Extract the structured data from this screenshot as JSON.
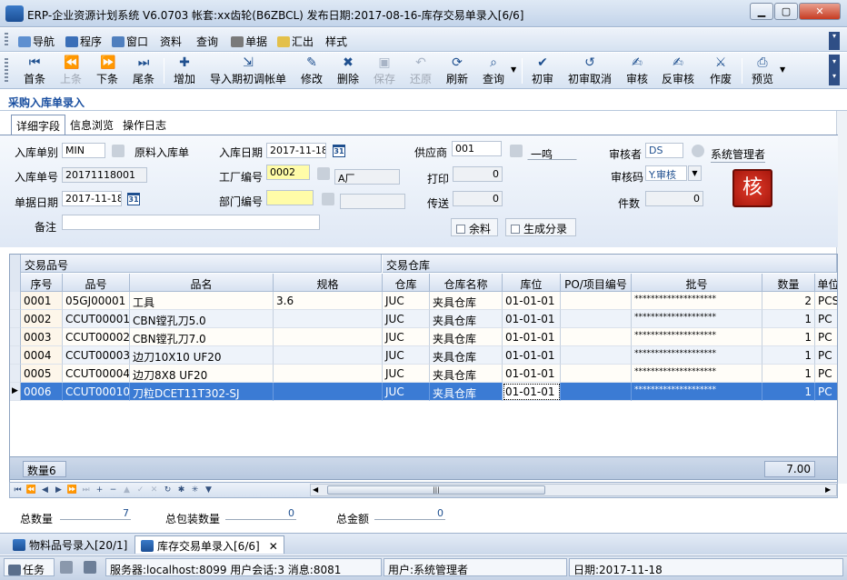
{
  "window": {
    "title": "ERP-企业资源计划系统 V6.0703 帐套:xx齿轮(B6ZBCL) 发布日期:2017-08-16-库存交易单录入[6/6]",
    "min": "▁",
    "max": "▢",
    "close": "✕"
  },
  "menu": {
    "items": [
      "导航",
      "程序",
      "窗口",
      "资料",
      "查询",
      "单据",
      "汇出",
      "样式"
    ]
  },
  "toolbar": {
    "buttons": [
      {
        "label": "首条",
        "icon": "first-record-icon",
        "glyph": "⏮"
      },
      {
        "label": "上条",
        "icon": "prev-record-icon",
        "glyph": "⏪"
      },
      {
        "label": "下条",
        "icon": "next-record-icon",
        "glyph": "⏩"
      },
      {
        "label": "尾条",
        "icon": "last-record-icon",
        "glyph": "⏭"
      },
      {
        "label": "增加",
        "icon": "add-icon",
        "glyph": "✚"
      },
      {
        "label": "导入期初调帐单",
        "icon": "import-icon",
        "glyph": "⇲"
      },
      {
        "label": "修改",
        "icon": "edit-icon",
        "glyph": "✎"
      },
      {
        "label": "删除",
        "icon": "delete-icon",
        "glyph": "✖"
      },
      {
        "label": "保存",
        "icon": "save-icon",
        "glyph": "💾"
      },
      {
        "label": "还原",
        "icon": "undo-icon",
        "glyph": "↶"
      },
      {
        "label": "刷新",
        "icon": "refresh-icon",
        "glyph": "⟳"
      },
      {
        "label": "查询",
        "icon": "query-icon",
        "glyph": "⌕"
      },
      {
        "label": "初审",
        "icon": "first-audit-icon",
        "glyph": "✔"
      },
      {
        "label": "初审取消",
        "icon": "first-audit-cancel-icon",
        "glyph": "↺"
      },
      {
        "label": "审核",
        "icon": "audit-icon",
        "glyph": "✍"
      },
      {
        "label": "反审核",
        "icon": "unaudit-icon",
        "glyph": "✍"
      },
      {
        "label": "作废",
        "icon": "void-icon",
        "glyph": "⚔"
      },
      {
        "label": "预览",
        "icon": "preview-icon",
        "glyph": "⎙"
      }
    ]
  },
  "form": {
    "title": "采购入库单录入",
    "tabs": [
      "详细字段",
      "信息浏览",
      "操作日志"
    ],
    "fields": {
      "type_label": "入库单别",
      "type_value": "MIN",
      "type_name": "原料入库单",
      "date_label": "入库日期",
      "date_value": "2017-11-18",
      "supplier_label": "供应商",
      "supplier_value": "001",
      "supplier_name": "一鸣",
      "auditor_label": "审核者",
      "auditor_value": "DS",
      "auditor_name": "系统管理者",
      "no_label": "入库单号",
      "no_value": "20171118001",
      "factory_label": "工厂编号",
      "factory_value": "0002",
      "factory_name": "A厂",
      "print_label": "打印",
      "print_value": "0",
      "auditcode_label": "审核码",
      "auditcode_value": "Y.审核",
      "billdate_label": "单据日期",
      "billdate_value": "2017-11-18",
      "dept_label": "部门编号",
      "dept_value": "",
      "dept_name": "",
      "send_label": "传送",
      "send_value": "0",
      "count_label": "件数",
      "count_value": "0",
      "remark_label": "备注",
      "remark_value": "",
      "surplus_label": "余料",
      "gen_label": "生成分录",
      "audit_badge": "核",
      "cal_glyph": "31"
    }
  },
  "grid": {
    "group1": "交易品号",
    "group2": "交易仓库",
    "columns": [
      "序号",
      "品号",
      "品名",
      "规格",
      "仓库",
      "仓库名称",
      "库位",
      "PO/项目编号",
      "批号",
      "数量",
      "单位"
    ],
    "rows": [
      [
        "0001",
        "05GJ00001",
        "工具",
        "3.6",
        "JUC",
        "夹具仓库",
        "01-01-01",
        "",
        "********************",
        "2",
        "PCS"
      ],
      [
        "0002",
        "CCUT00001",
        "CBN镗孔刀5.0",
        "",
        "JUC",
        "夹具仓库",
        "01-01-01",
        "",
        "********************",
        "1",
        "PC"
      ],
      [
        "0003",
        "CCUT00002",
        "CBN镗孔刀7.0",
        "",
        "JUC",
        "夹具仓库",
        "01-01-01",
        "",
        "********************",
        "1",
        "PC"
      ],
      [
        "0004",
        "CCUT00003",
        "边刀10X10 UF20",
        "",
        "JUC",
        "夹具仓库",
        "01-01-01",
        "",
        "********************",
        "1",
        "PC"
      ],
      [
        "0005",
        "CCUT00004",
        "边刀8X8 UF20",
        "",
        "JUC",
        "夹具仓库",
        "01-01-01",
        "",
        "********************",
        "1",
        "PC"
      ],
      [
        "0006",
        "CCUT00010",
        "刀粒DCET11T302-SJ",
        "",
        "JUC",
        "夹具仓库",
        "01-01-01",
        "",
        "********************",
        "1",
        "PC"
      ]
    ],
    "current_indicator": "▶",
    "footer_count": "数量6",
    "footer_total": "7.00"
  },
  "navigator": {
    "buttons": [
      "⏮",
      "⏪",
      "◀",
      "▶",
      "⏩",
      "⏭",
      "+",
      "−",
      "▲",
      "✓",
      "✕",
      "↻",
      "✱",
      "✳",
      "▼"
    ],
    "scroll_grip": "|||"
  },
  "totals": {
    "qty_label": "总数量",
    "qty_value": "7",
    "pack_label": "总包装数量",
    "pack_value": "0",
    "amount_label": "总金额",
    "amount_value": "0"
  },
  "doctabs": [
    "物料品号录入[20/1]",
    "库存交易单录入[6/6]"
  ],
  "doctab_close": "✕",
  "status": {
    "tasks": "任务",
    "server": "服务器:localhost:8099 用户会话:3 消息:8081",
    "user": "用户:系统管理者",
    "date": "日期:2017-11-18"
  }
}
